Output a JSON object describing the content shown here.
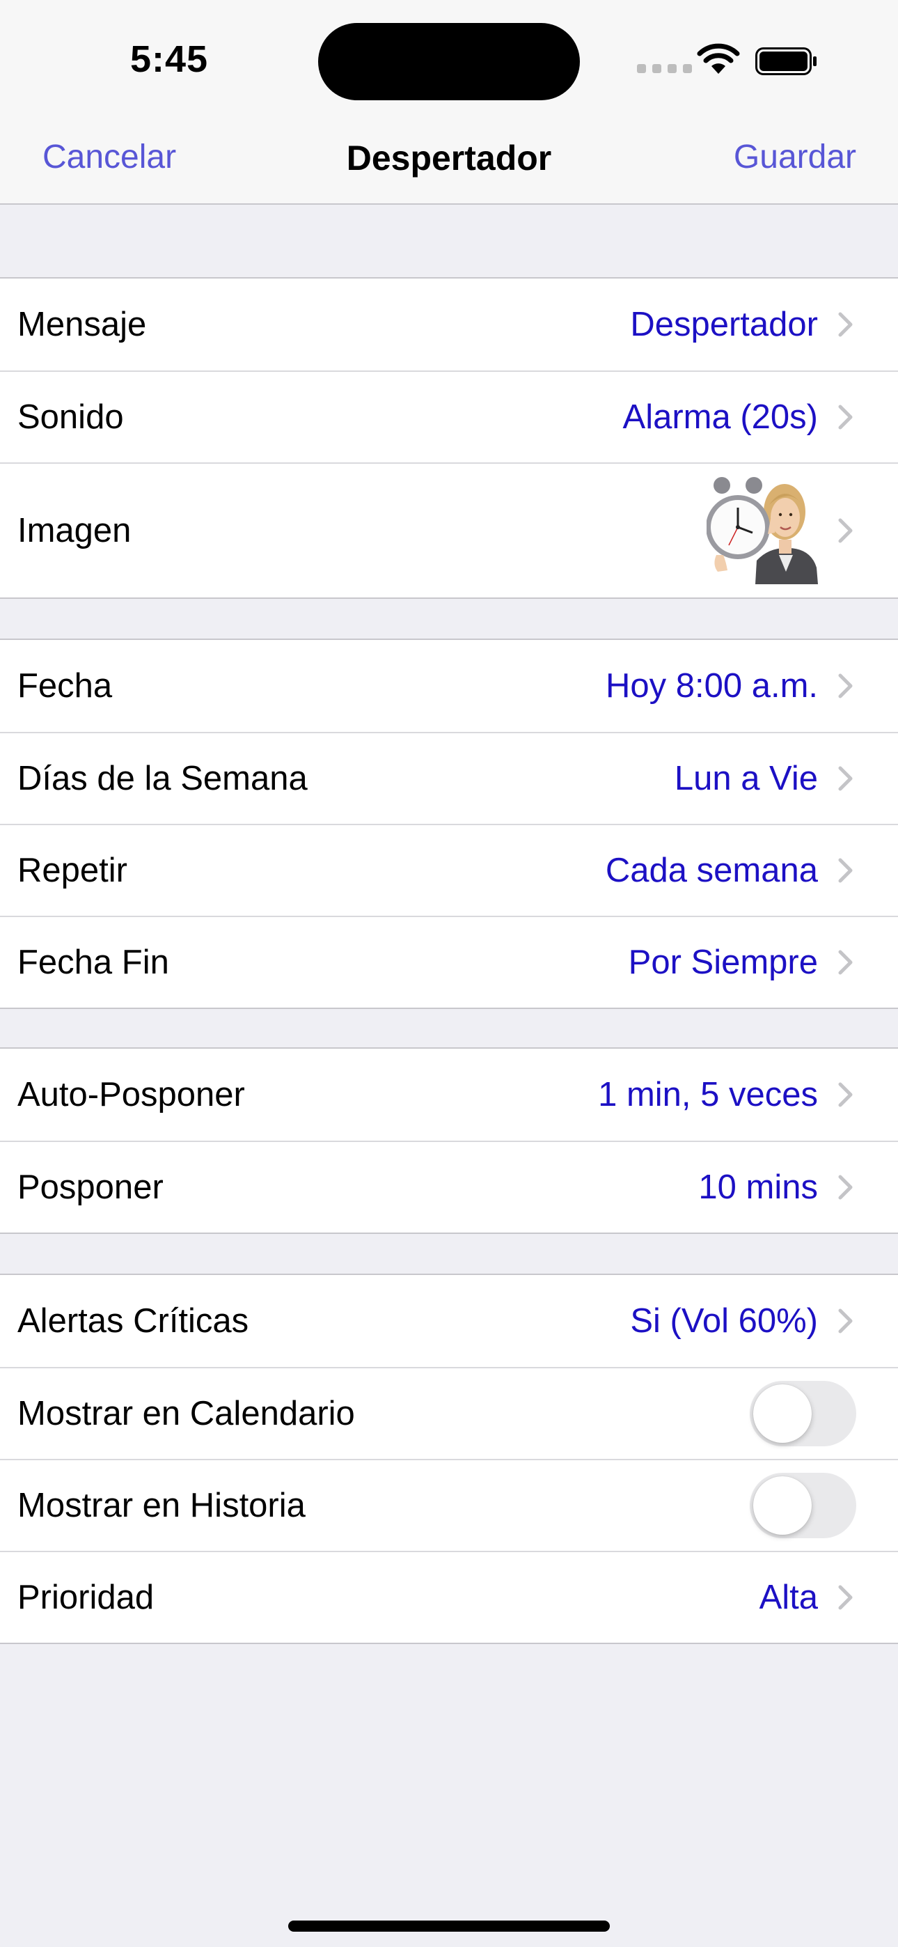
{
  "status_bar": {
    "time": "5:45",
    "wifi_icon": "wifi-icon",
    "battery_icon": "battery-full-icon"
  },
  "nav": {
    "cancel_label": "Cancelar",
    "title": "Despertador",
    "save_label": "Guardar"
  },
  "colors": {
    "accent": "#5856d6",
    "value_text": "#1c10c4",
    "background": "#efeff4"
  },
  "rows": {
    "mensaje": {
      "label": "Mensaje",
      "value": "Despertador"
    },
    "sonido": {
      "label": "Sonido",
      "value": "Alarma (20s)"
    },
    "imagen": {
      "label": "Imagen",
      "thumbnail": "woman-holding-alarm-clock"
    },
    "fecha": {
      "label": "Fecha",
      "value": "Hoy 8:00 a.m."
    },
    "dias": {
      "label": "Días de la Semana",
      "value": "Lun a Vie"
    },
    "repetir": {
      "label": "Repetir",
      "value": "Cada semana"
    },
    "fecha_fin": {
      "label": "Fecha Fin",
      "value": "Por Siempre"
    },
    "auto_posponer": {
      "label": "Auto-Posponer",
      "value": "1 min, 5 veces"
    },
    "posponer": {
      "label": "Posponer",
      "value": "10 mins"
    },
    "alertas": {
      "label": "Alertas Críticas",
      "value": "Si (Vol 60%)"
    },
    "calendario": {
      "label": "Mostrar en Calendario",
      "toggle_on": false
    },
    "historia": {
      "label": "Mostrar en Historia",
      "toggle_on": false
    },
    "prioridad": {
      "label": "Prioridad",
      "value": "Alta"
    }
  }
}
